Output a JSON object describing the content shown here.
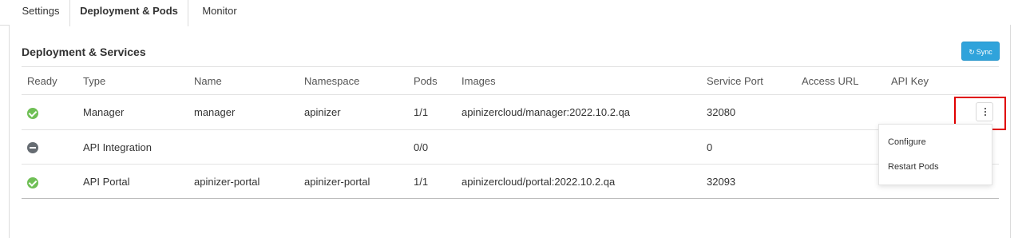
{
  "tabs": [
    {
      "label": "Settings",
      "active": false
    },
    {
      "label": "Deployment & Pods",
      "active": true
    },
    {
      "label": "Monitor",
      "active": false
    }
  ],
  "panel": {
    "title": "Deployment & Services",
    "sync_label": "Sync",
    "sync_color": "#2fa3db"
  },
  "table": {
    "columns": [
      "Ready",
      "Type",
      "Name",
      "Namespace",
      "Pods",
      "Images",
      "Service Port",
      "Access URL",
      "API Key"
    ],
    "rows": [
      {
        "ready": "ok",
        "type": "Manager",
        "name": "manager",
        "namespace": "apinizer",
        "pods": "1/1",
        "images": "apinizercloud/manager:2022.10.2.qa",
        "service_port": "32080",
        "access_url": "",
        "api_key": ""
      },
      {
        "ready": "stopped",
        "type": "API Integration",
        "name": "",
        "namespace": "",
        "pods": "0/0",
        "images": "",
        "service_port": "0",
        "access_url": "",
        "api_key": ""
      },
      {
        "ready": "ok",
        "type": "API Portal",
        "name": "apinizer-portal",
        "namespace": "apinizer-portal",
        "pods": "1/1",
        "images": "apinizercloud/portal:2022.10.2.qa",
        "service_port": "32093",
        "access_url": "",
        "api_key": ""
      }
    ]
  },
  "row_menu": {
    "items": [
      "Configure",
      "Restart Pods"
    ]
  },
  "colors": {
    "ready_ok": "#6fbf55",
    "ready_stopped": "#666c72",
    "highlight": "#e00000"
  },
  "icons": {
    "sync": "refresh-icon",
    "row_menu": "vertical-ellipsis-icon"
  }
}
